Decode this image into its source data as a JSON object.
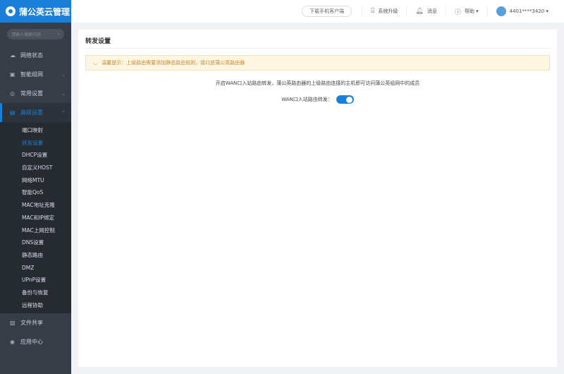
{
  "app": {
    "title": "蒲公英云管理"
  },
  "header": {
    "download": "下载手机客户端",
    "upgrade": "系统升级",
    "messages": "消息",
    "help": "帮助",
    "user": "4401****3420"
  },
  "sidebar": {
    "search_placeholder": "请输入搜索内容",
    "items": [
      {
        "label": "网络状态",
        "icon": "cloud-icon"
      },
      {
        "label": "智能组网",
        "icon": "network-icon"
      },
      {
        "label": "常用设置",
        "icon": "settings-icon"
      },
      {
        "label": "高级设置",
        "icon": "advanced-icon"
      }
    ],
    "sub": [
      "端口映射",
      "转发设置",
      "DHCP设置",
      "自定义HOST",
      "网络MTU",
      "智能QoS",
      "MAC地址克隆",
      "MAC和IP绑定",
      "MAC上网控制",
      "DNS设置",
      "静态路由",
      "DMZ",
      "UPnP设置",
      "备份与恢复",
      "远程协助"
    ],
    "bottom": [
      {
        "label": "文件共享"
      },
      {
        "label": "应用中心"
      }
    ]
  },
  "main": {
    "title": "转发设置",
    "warning": "温馨提示：上级路由需要添加静态路由规则，接口是蒲公英路由器",
    "description": "开启WAN口入站路由转发，蒲公英路由器的上级路由连接的主机即可访问蒲公英组网中的成员",
    "toggle_label": "WAN口入站路由转发：",
    "toggle_on": true
  },
  "colors": {
    "accent": "#1a7fd8",
    "sidebar": "#363d47",
    "warning_bg": "#fdf6e3"
  }
}
